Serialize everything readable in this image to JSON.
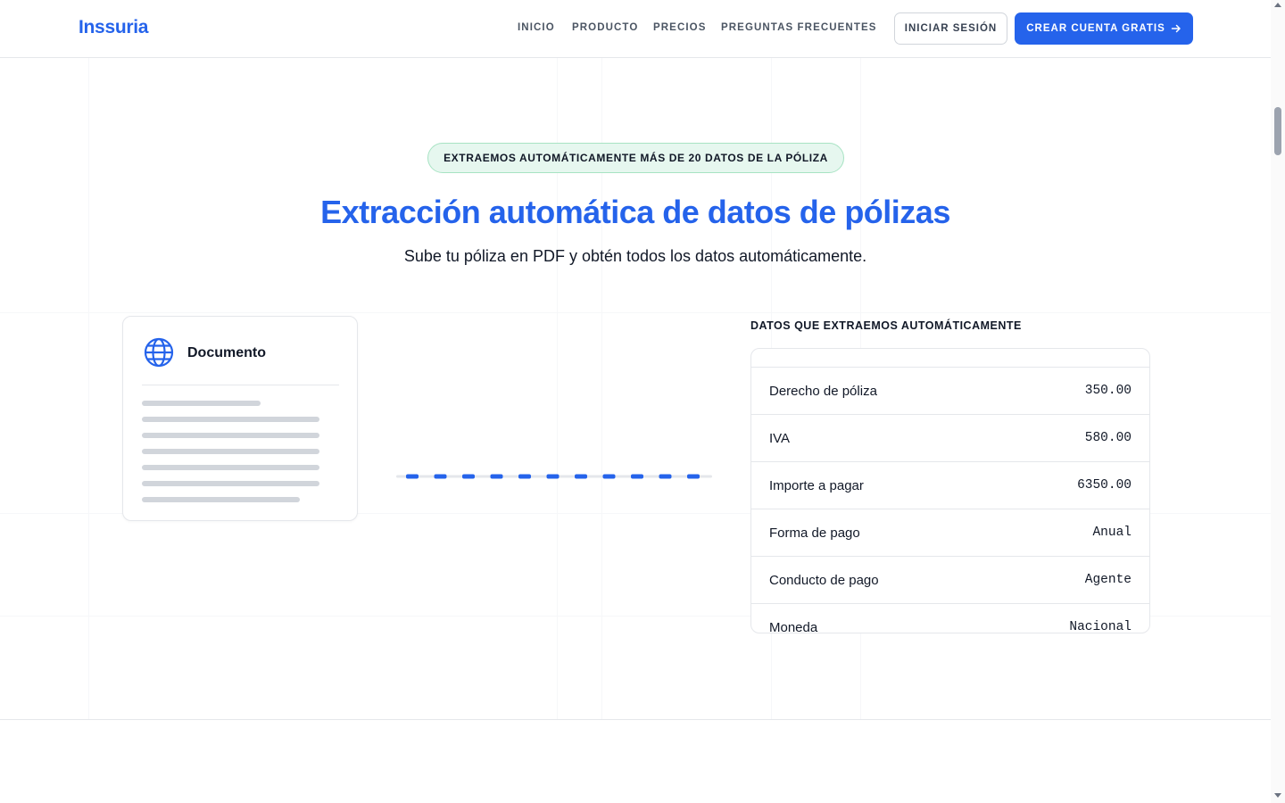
{
  "header": {
    "logo": "Inssuria",
    "nav": [
      {
        "label": "INICIO"
      },
      {
        "label": "PRODUCTO"
      },
      {
        "label": "PRECIOS"
      },
      {
        "label": "PREGUNTAS FRECUENTES"
      }
    ],
    "login_label": "INICIAR SESIÓN",
    "cta_label": "CREAR CUENTA GRATIS",
    "cta_icon": "arrow-right-icon"
  },
  "hero": {
    "badge": "EXTRAEMOS AUTOMÁTICAMENTE MÁS DE 20 DATOS DE LA PÓLIZA",
    "title": "Extracción automática de datos de pólizas",
    "subtitle": "Sube tu póliza en PDF y obtén todos los datos automáticamente."
  },
  "document": {
    "title": "Documento",
    "icon": "globe-icon"
  },
  "panel": {
    "label": "DATOS QUE EXTRAEMOS AUTOMÁTICAMENTE",
    "rows": [
      {
        "label": "Derecho de póliza",
        "value": "350.00"
      },
      {
        "label": "IVA",
        "value": "580.00"
      },
      {
        "label": "Importe a pagar",
        "value": "6350.00"
      },
      {
        "label": "Forma de pago",
        "value": "Anual"
      },
      {
        "label": "Conducto de pago",
        "value": "Agente"
      },
      {
        "label": "Moneda",
        "value": "Nacional"
      }
    ]
  },
  "colors": {
    "primary": "#2563eb",
    "badge_bg": "#e6f7ef",
    "badge_border": "#a7e3c3"
  }
}
